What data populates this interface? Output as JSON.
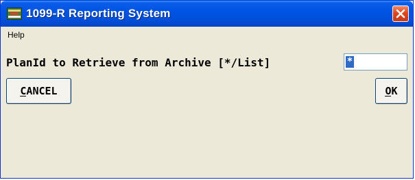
{
  "window": {
    "title": "1099-R Reporting System",
    "icon": "app-logo-icon",
    "close_icon": "close-icon"
  },
  "menu": {
    "items": [
      "Help"
    ]
  },
  "form": {
    "prompt": "PlanId to Retrieve from Archive [*/List]",
    "plan_id_value": "*"
  },
  "buttons": {
    "cancel_label": "CANCEL",
    "ok_label": "OK"
  },
  "colors": {
    "titlebar": "#0054e3",
    "close_button": "#e2461d",
    "dialog_background": "#ece9d8",
    "selection": "#316ac5"
  }
}
